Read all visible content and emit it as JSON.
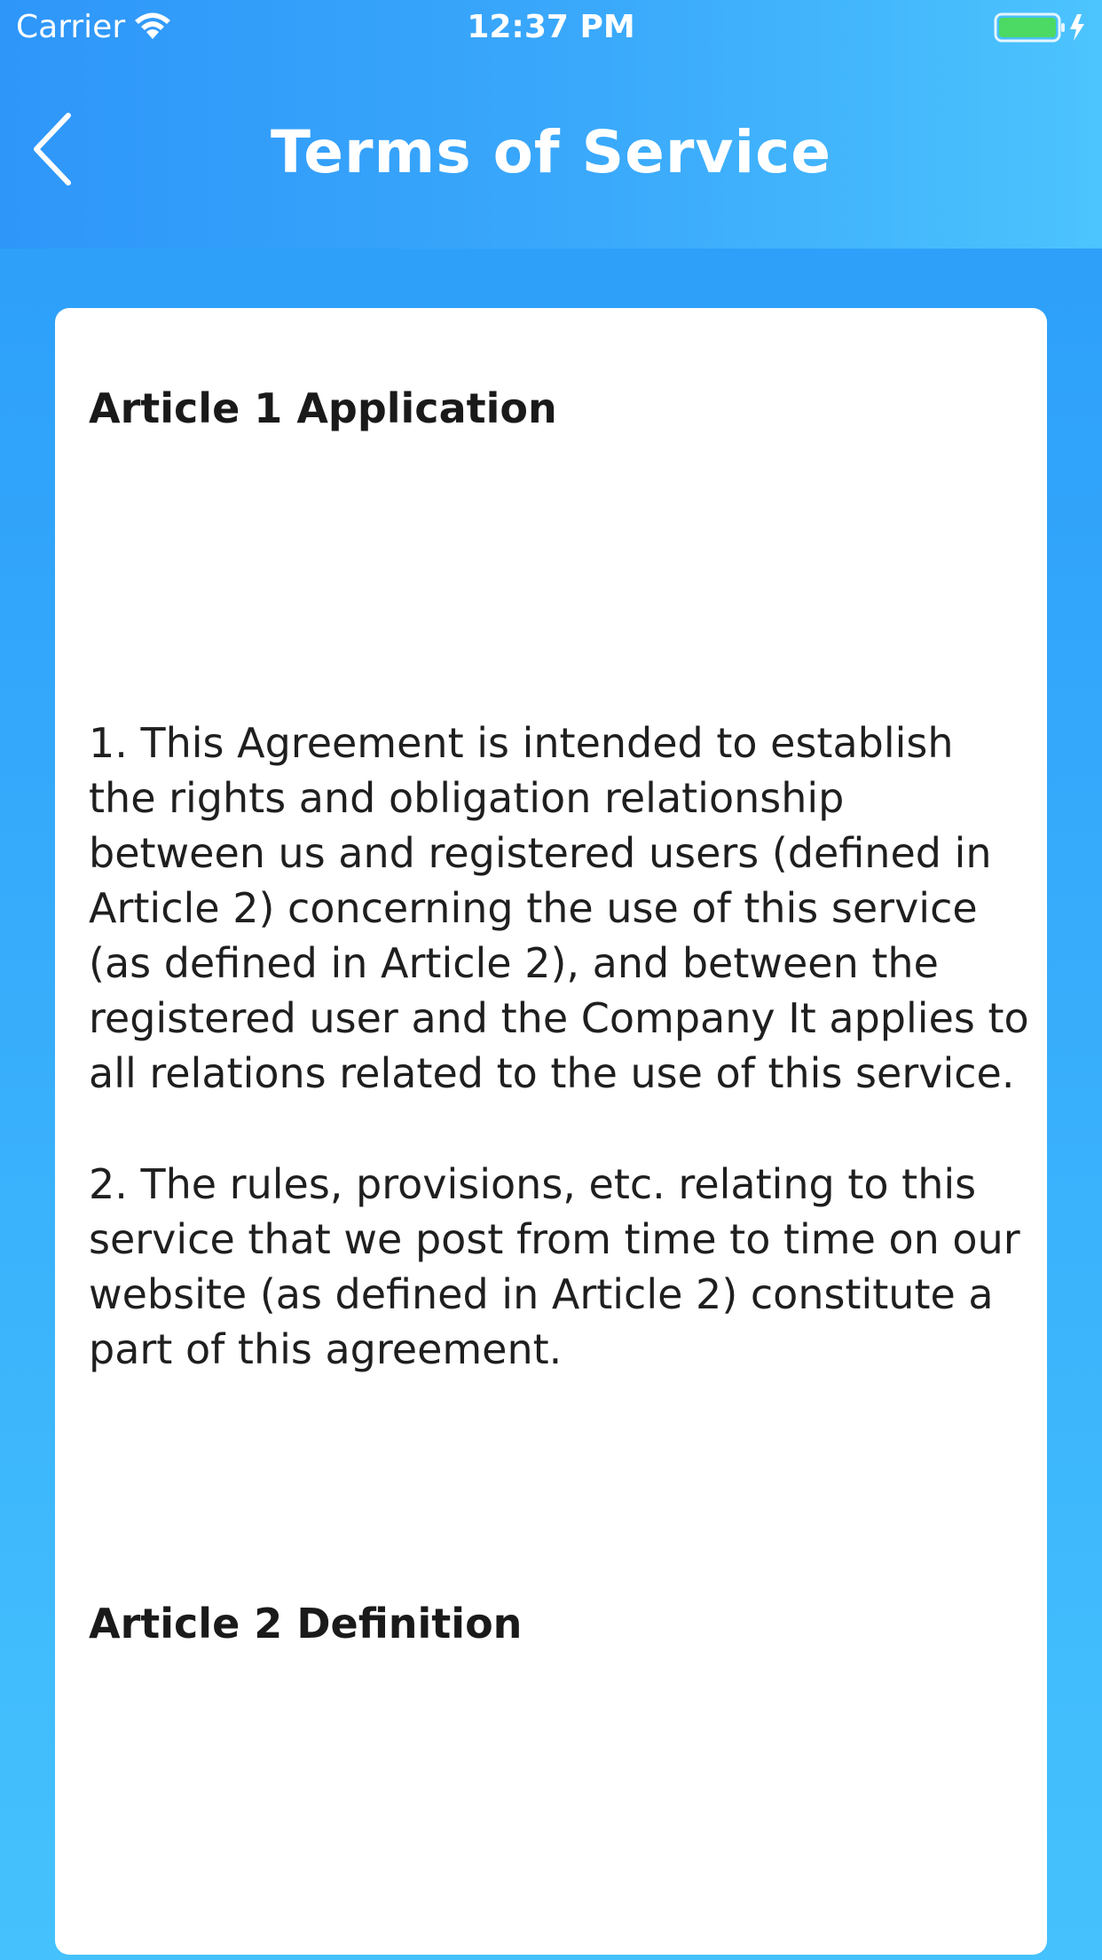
{
  "status_bar": {
    "carrier": "Carrier",
    "time": "12:37 PM",
    "icons": [
      "wifi-icon",
      "battery-charging-icon"
    ]
  },
  "nav": {
    "title": "Terms of Service",
    "back_icon": "chevron-left-icon"
  },
  "content": {
    "article1": {
      "heading": "Article 1 Application",
      "paragraphs": [
        "1. This Agreement is intended to establish the rights and obligation relationship between us and registered users (defined in Article 2) concerning the use of this service (as defined in Article 2), and between the registered user and the Company It applies to all relations related to the use of this service.",
        "2. The rules, provisions, etc. relating to this service that we post from time to time on our website (as defined in Article 2) constitute a part of this agreement."
      ]
    },
    "article2": {
      "heading": "Article 2 Definition"
    }
  },
  "colors": {
    "header_gradient_start": "#2e96f9",
    "header_gradient_end": "#4cc4fd",
    "background_top": "#2a9bfa",
    "background_bottom": "#45c2fd",
    "card": "#ffffff",
    "battery_fill": "#4cd964"
  }
}
